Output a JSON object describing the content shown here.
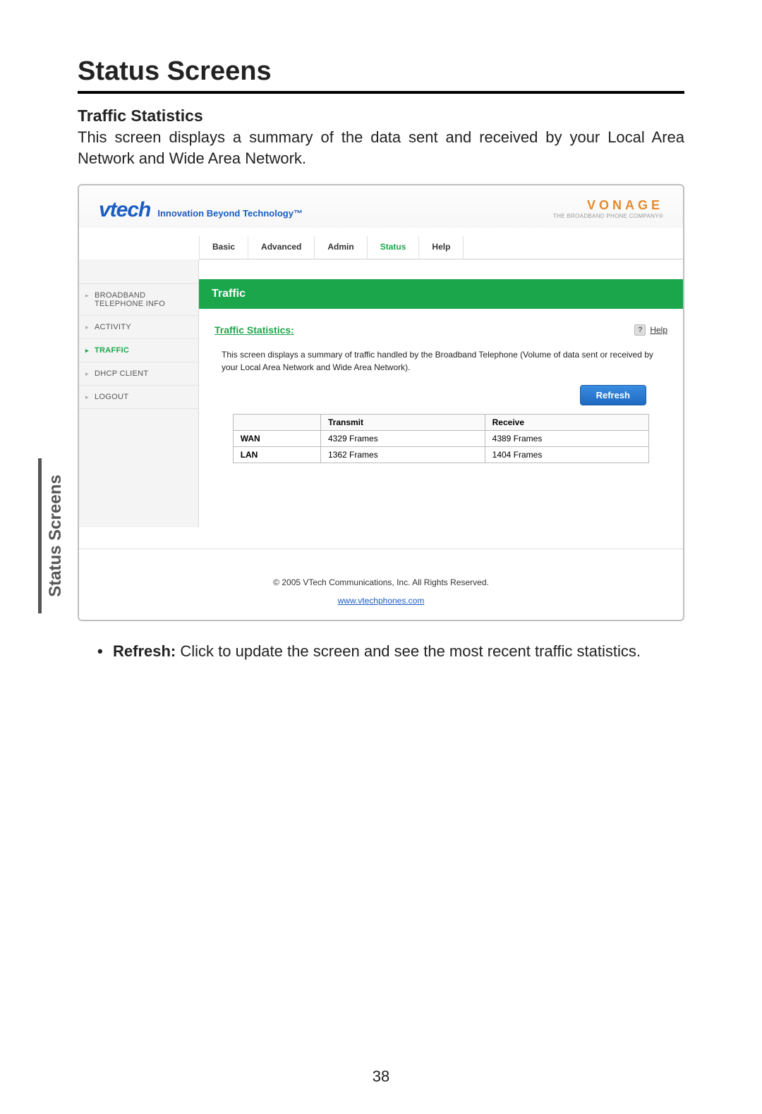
{
  "doc": {
    "heading": "Status Screens",
    "sub_heading": "Traffic Statistics",
    "intro": "This screen displays a summary of the data sent and received by your Local Area Network and Wide Area Network.",
    "side_tab": "Status Screens",
    "page_number": "38"
  },
  "logo": {
    "brand": "vtech",
    "tagline": "Innovation Beyond Technology™",
    "partner": "VONAGE",
    "partner_tag": "THE BROADBAND PHONE COMPANY®"
  },
  "topnav": {
    "items": [
      "Basic",
      "Advanced",
      "Admin",
      "Status",
      "Help"
    ],
    "active_index": 3
  },
  "sidebar": {
    "items": [
      "BROADBAND TELEPHONE INFO",
      "ACTIVITY",
      "TRAFFIC",
      "DHCP CLIENT",
      "LOGOUT"
    ],
    "active_index": 2
  },
  "panel": {
    "title": "Traffic",
    "stats_title": "Traffic Statistics:",
    "help_label": "Help",
    "description": "This screen displays a summary of traffic handled by the Broadband Telephone (Volume of data sent or received by your Local Area Network and Wide Area Network).",
    "refresh_label": "Refresh",
    "table": {
      "headers": [
        "",
        "Transmit",
        "Receive"
      ],
      "rows": [
        {
          "label": "WAN",
          "transmit": "4329 Frames",
          "receive": "4389 Frames"
        },
        {
          "label": "LAN",
          "transmit": "1362 Frames",
          "receive": "1404 Frames"
        }
      ]
    }
  },
  "footer": {
    "copyright": "© 2005 VTech Communications, Inc. All Rights Reserved.",
    "link": "www.vtechphones.com"
  },
  "bullet": {
    "label": "Refresh:",
    "text": " Click to update the screen and see the most recent traffic statistics."
  }
}
